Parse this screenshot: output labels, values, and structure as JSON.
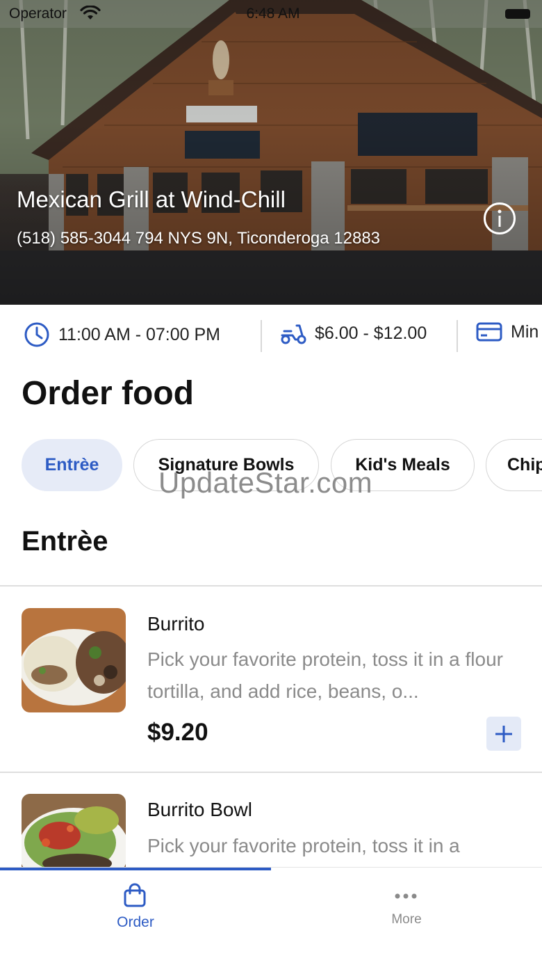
{
  "status_bar": {
    "carrier": "Operator",
    "time": "6:48 AM"
  },
  "restaurant": {
    "name": "Mexican Grill at Wind-Chill",
    "address": "(518) 585-3044 794 NYS 9N, Ticonderoga 12883"
  },
  "info_strip": {
    "hours": "11:00 AM - 07:00 PM",
    "delivery_fee": "$6.00 - $12.00",
    "minimum": "Min"
  },
  "page": {
    "title": "Order food"
  },
  "categories": [
    {
      "label": "Entrèe",
      "selected": true
    },
    {
      "label": "Signature Bowls",
      "selected": false
    },
    {
      "label": "Kid's Meals",
      "selected": false
    },
    {
      "label": "Chip",
      "selected": false
    }
  ],
  "watermark": "UpdateStar.com",
  "section": {
    "title": "Entrèe"
  },
  "menu_items": [
    {
      "name": "Burrito",
      "description": "Pick your favorite protein, toss it in a flour tortilla, and add rice, beans, o...",
      "price": "$9.20"
    },
    {
      "name": "Burrito Bowl",
      "description": "Pick your favorite protein, toss it in a"
    }
  ],
  "tab_bar": {
    "order_label": "Order",
    "more_label": "More",
    "active_tab": "Order"
  },
  "colors": {
    "accent": "#2d5bc4",
    "chip_active_bg": "#e6ebf7",
    "muted_text": "#8a8a8a"
  },
  "icons": {
    "hours": "clock-icon",
    "delivery": "scooter-icon",
    "minimum": "card-icon",
    "info": "info-icon",
    "add": "plus-icon",
    "order_tab": "shopping-bag-icon",
    "more_tab": "more-dots-icon"
  }
}
